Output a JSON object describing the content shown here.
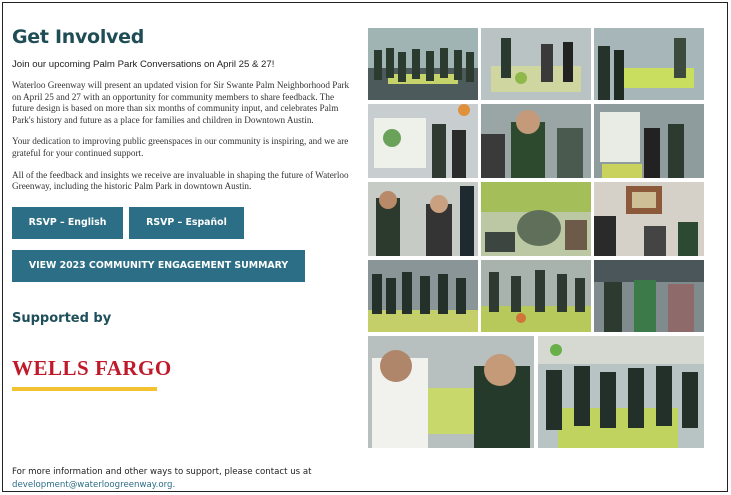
{
  "section": {
    "title": "Get Involved",
    "subtitle": "Join our upcoming Palm Park Conversations on April 25 & 27!",
    "paragraph1": "Waterloo Greenway will present an updated vision for Sir Swante Palm Neighborhood Park on April 25 and 27 with an opportunity for community members to share feedback. The future design is based on more than six months of community input, and celebrates Palm Park's history and future as a place for families and children in Downtown Austin.",
    "paragraph2": "Your dedication to improving public greenspaces in our community is inspiring, and we are grateful for your continued support.",
    "paragraph3": "All of the feedback and insights we receive are invaluable in shaping the future of Waterloo Greenway, including the historic Palm Park in downtown Austin."
  },
  "buttons": {
    "rsvp_english": "RSVP – English",
    "rsvp_espanol": "RSVP – Español",
    "summary": "VIEW 2023 COMMUNITY ENGAGEMENT SUMMARY"
  },
  "sponsor": {
    "heading": "Supported by",
    "logo_text": "WELLS FARGO"
  },
  "contact": {
    "text": "For more information and other ways to support, please contact us at",
    "email": "development@waterloogreenway.org."
  },
  "colors": {
    "title": "#1f4d55",
    "button": "#2c6e86",
    "logo_red": "#c0192a",
    "logo_gold": "#f2c230"
  }
}
